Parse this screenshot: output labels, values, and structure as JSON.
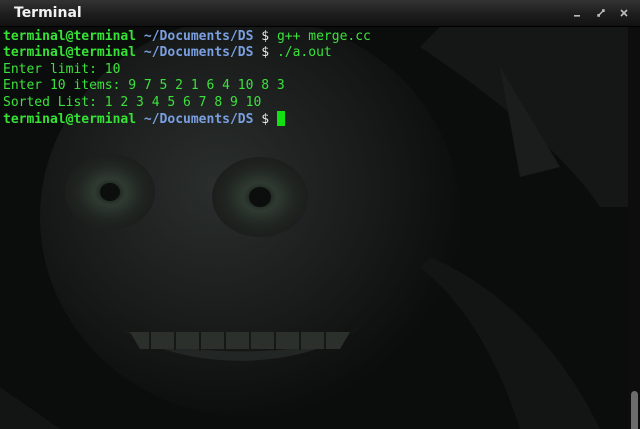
{
  "window": {
    "title": "Terminal",
    "controls": {
      "minimize_icon": "minimize-icon",
      "maximize_icon": "maximize-icon",
      "close_icon": "close-icon"
    }
  },
  "terminal": {
    "prompt_user": "terminal@terminal",
    "prompt_path": "~/Documents/DS",
    "prompt_symbol": "$",
    "lines": [
      {
        "type": "prompt",
        "command": "g++ merge.cc"
      },
      {
        "type": "prompt",
        "command": "./a.out"
      },
      {
        "type": "output",
        "text": "Enter limit: 10"
      },
      {
        "type": "output",
        "text": "Enter 10 items: 9 7 5 2 1 6 4 10 8 3"
      },
      {
        "type": "output",
        "text": "Sorted List: 1 2 3 4 5 6 7 8 9 10"
      },
      {
        "type": "prompt",
        "command": ""
      }
    ]
  },
  "colors": {
    "prompt_user": "#35e235",
    "prompt_path": "#7a9fe0",
    "output_text": "#3be23b",
    "cursor": "#12e012",
    "background": "#0b0d0c",
    "titlebar": "#1d1d1d"
  }
}
